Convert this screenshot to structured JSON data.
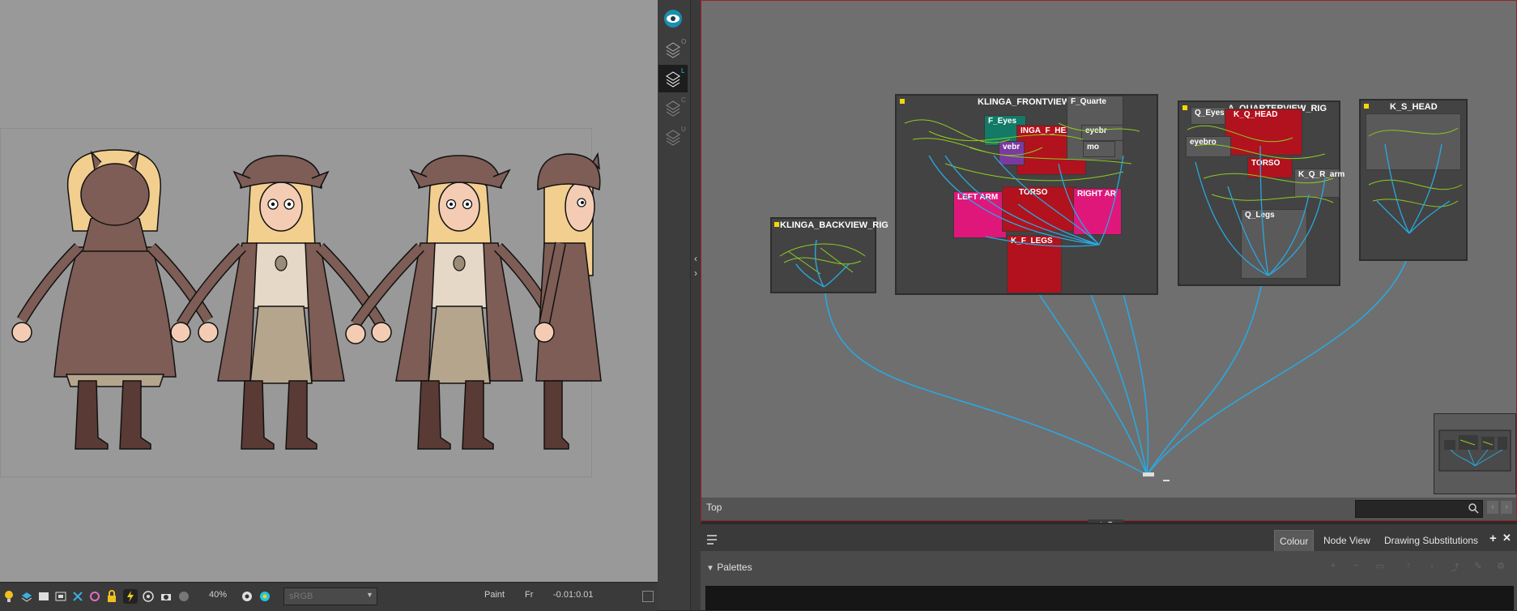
{
  "viewer": {
    "toolbar": {
      "zoom": "40%",
      "colorspace": "sRGB",
      "mode": "Paint",
      "frame": "Fr",
      "timecode": "-0.01:0.01"
    }
  },
  "viewbar": {
    "buttons": [
      {
        "icon": "eye-icon",
        "badge": ""
      },
      {
        "icon": "layers-icon",
        "badge": "O"
      },
      {
        "icon": "layers-icon",
        "badge": "L"
      },
      {
        "icon": "layers-icon",
        "badge": "C"
      },
      {
        "icon": "layers-icon",
        "badge": "U"
      }
    ]
  },
  "nodeview": {
    "level": "Top",
    "search_placeholder": "",
    "groups": {
      "backview": "KLINGA_BACKVIEW_RIG",
      "frontview": "KLINGA_FRONTVIEW_RIG",
      "quarterview": "A_QUARTERVIEW_RIG",
      "sideview": "K_S_HEAD"
    },
    "subgroups": {
      "f_eyes": "F_Eyes",
      "f_head": "INGA_F_HEA",
      "f_quarter": "F_Quarte",
      "f_eyebrow": "eyebr",
      "f_mouth": "mo",
      "f_eyebrow2": "vebr",
      "f_left_arm": "LEFT ARM",
      "f_torso": "TORSO",
      "f_right_arm": "RIGHT AR",
      "f_legs": "K_F_LEGS",
      "q_eyes": "Q_Eyes",
      "q_head": "K_Q_HEAD",
      "q_eyebrow": "eyebro",
      "q_r_arm": "K_Q_R_arm",
      "q_torso": "TORSO",
      "q_legs": "Q_Legs"
    }
  },
  "bottom_panel": {
    "tabs": [
      "Colour",
      "Node View",
      "Drawing Substitutions"
    ],
    "active_tab": "Colour",
    "section": "Palettes"
  },
  "colors": {
    "wire_blue": "#29a8e0",
    "wire_green": "#8bcc22",
    "group_red": "#b1121d",
    "group_pink": "#e0177a",
    "group_teal": "#127a66",
    "accent_cyan": "#23c3e0"
  }
}
